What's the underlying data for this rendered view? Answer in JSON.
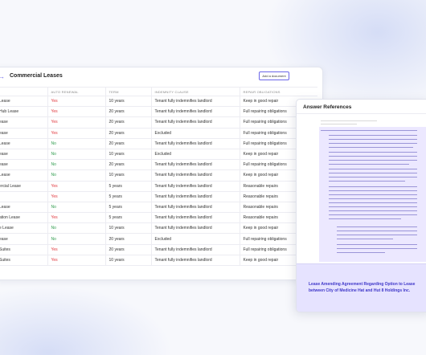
{
  "panel": {
    "title": "Commercial Leases",
    "add_document": "Add a document",
    "more_link": "e"
  },
  "table": {
    "columns": [
      "",
      "AUTO RENEWAL",
      "TERM",
      "INDEMNITY CLAUSE",
      "REPAIR OBLIGATIONS"
    ],
    "rows": [
      [
        "Lease",
        "Yes",
        "10 years",
        "Tenant fully indemnifies landlord",
        "Keep in good repair"
      ],
      [
        "Hub Lease",
        "Yes",
        "20 years",
        "Tenant fully indemnifies landlord",
        "Full repairing obligations"
      ],
      [
        "ease",
        "Yes",
        "20 years",
        "Tenant fully indemnifies landlord",
        "Full repairing obligations"
      ],
      [
        "ease",
        "Yes",
        "20 years",
        "Excluded",
        "Full repairing obligations"
      ],
      [
        "Lease",
        "No",
        "20 years",
        "Tenant fully indemnifies landlord",
        "Full repairing obligations"
      ],
      [
        "ease",
        "No",
        "10 years",
        "Excluded",
        "Keep in good repair"
      ],
      [
        "ease",
        "No",
        "20 years",
        "Tenant fully indemnifies landlord",
        "Full repairing obligations"
      ],
      [
        "Lease",
        "No",
        "10 years",
        "Tenant fully indemnifies landlord",
        "Keep in good repair"
      ],
      [
        "ercial Lease",
        "Yes",
        "5 years",
        "Tenant fully indemnifies landlord",
        "Reasonable repairs"
      ],
      [
        "",
        "Yes",
        "5 years",
        "Tenant fully indemnifies landlord",
        "Reasonable repairs"
      ],
      [
        "Lease",
        "No",
        "5 years",
        "Tenant fully indemnifies landlord",
        "Reasonable repairs"
      ],
      [
        "ation Lease",
        "Yes",
        "5 years",
        "Tenant fully indemnifies landlord",
        "Reasonable repairs"
      ],
      [
        "e Lease",
        "No",
        "10 years",
        "Tenant fully indemnifies landlord",
        "Keep in good repair"
      ],
      [
        "ease",
        "No",
        "20 years",
        "Excluded",
        "Full repairing obligations"
      ],
      [
        "Suites",
        "Yes",
        "20 years",
        "Tenant fully indemnifies landlord",
        "Full repairing obligations"
      ],
      [
        "Suites",
        "Yes",
        "10 years",
        "Tenant fully indemnifies landlord",
        "Keep in good repair"
      ]
    ]
  },
  "references": {
    "title": "Answer References",
    "footer": "Lease Amending Agreement Regarding Option to Lease between City of Medicine Hat and Hut 8 Holdings Inc."
  },
  "colors": {
    "accent": "#6b66e8",
    "yes": "#e0383e",
    "no": "#2f9c4d",
    "highlight": "#ece8ff"
  }
}
